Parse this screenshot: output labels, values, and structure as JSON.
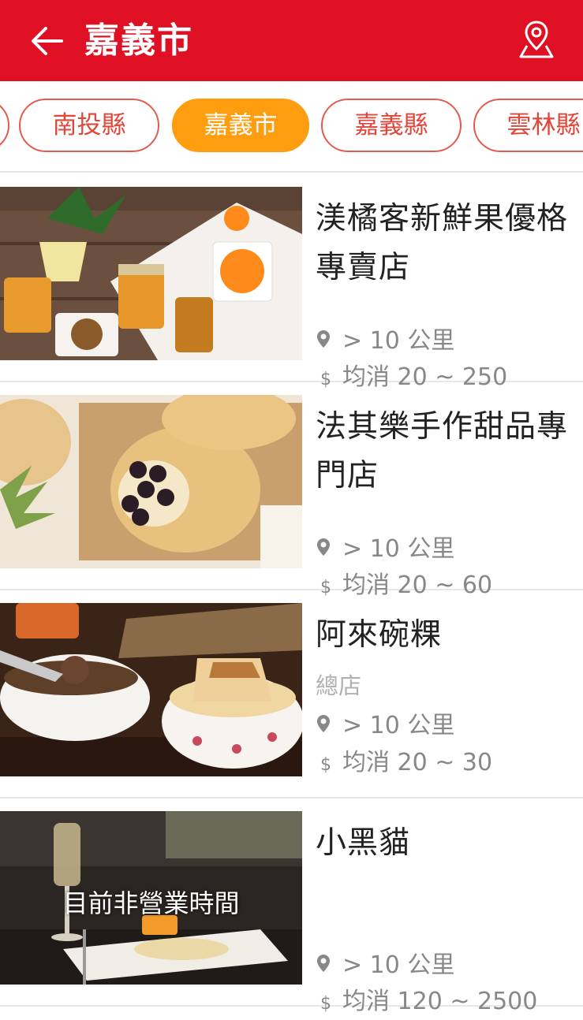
{
  "header": {
    "title": "嘉義市",
    "back_icon": "arrow-left-icon",
    "map_icon": "map-pin-icon",
    "bg_color": "#df0f24"
  },
  "tabs": [
    {
      "label": "南投縣",
      "active": false
    },
    {
      "label": "嘉義市",
      "active": true
    },
    {
      "label": "嘉義縣",
      "active": false
    },
    {
      "label": "雲林縣",
      "active": false
    }
  ],
  "accent_color": "#ff9d10",
  "shops": [
    {
      "name": "渼橘客新鮮果優格專賣店",
      "branch": "",
      "distance": "> 10 公里",
      "price": "均消 20 ~ 250",
      "closed_label": ""
    },
    {
      "name": "法其樂手作甜品專門店",
      "branch": "",
      "distance": "> 10 公里",
      "price": "均消 20 ~ 60",
      "closed_label": ""
    },
    {
      "name": "阿來碗粿",
      "branch": "總店",
      "distance": "> 10 公里",
      "price": "均消 20 ~ 30",
      "closed_label": ""
    },
    {
      "name": "小黑貓",
      "branch": "",
      "distance": "> 10 公里",
      "price": "均消 120 ~ 2500",
      "closed_label": "目前非營業時間"
    }
  ]
}
